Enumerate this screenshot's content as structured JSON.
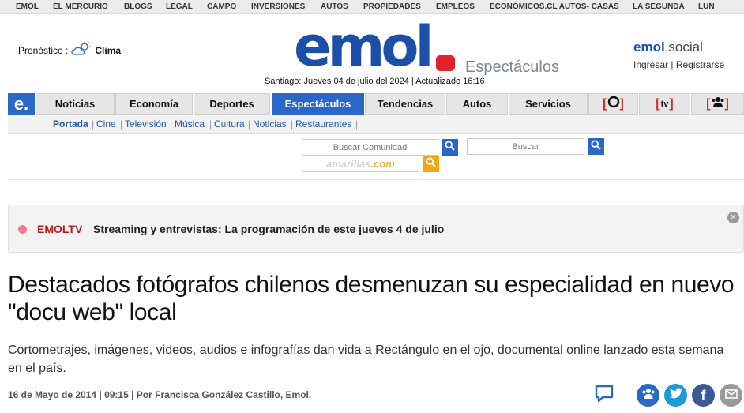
{
  "topbar": {
    "links": [
      "EMOL",
      "EL MERCURIO",
      "BLOGS",
      "LEGAL",
      "CAMPO",
      "INVERSIONES",
      "AUTOS",
      "PROPIEDADES",
      "EMPLEOS",
      "ECONÓMICOS.CL AUTOS- CASAS",
      "LA SEGUNDA",
      "LUN"
    ]
  },
  "header": {
    "forecast_label": "Pronóstico :",
    "forecast_link": "Clima",
    "logo": "emol",
    "section": "Espectáculos",
    "date_line": "Santiago: Jueves 04 de julio del 2024 | Actualizado 16:16",
    "social": {
      "logo_main": "emol",
      "logo_dot": ".",
      "logo_suffix": "social",
      "login": "Ingresar",
      "separator": "|",
      "register": "Registrarse"
    }
  },
  "nav": {
    "logo": "e.",
    "tabs": [
      "Noticias",
      "Economía",
      "Deportes",
      "Espectáculos",
      "Tendencias",
      "Autos",
      "Servicios"
    ],
    "active_tab": "Espectáculos",
    "icon_tabs": [
      "radio-icon",
      "tv-icon",
      "community-icon"
    ],
    "tv_icon_text": "tv"
  },
  "subnav": {
    "items": [
      "Portada",
      "Cine",
      "Televisión",
      "Música",
      "Cultura",
      "Noticias",
      "Restaurantes"
    ],
    "separator": "|"
  },
  "search": {
    "community_placeholder": "Buscar Comunidad",
    "site_placeholder": "Buscar",
    "amarillas_brand": "amarillas",
    "amarillas_suffix": ".com"
  },
  "alert": {
    "tag": "EMOLTV",
    "text": "Streaming y entrevistas: La programación de este jueves 4 de julio"
  },
  "article": {
    "headline": "Destacados fotógrafos chilenos desmenuzan su especialidad en nuevo \"docu web\" local",
    "summary": "Cortometrajes, imágenes, videos, audios e infografías dan vida a Rectángulo en el ojo, documental online lanzado esta semana en el país.",
    "byline": "16 de Mayo de 2014 | 09:15 | Por Francisca González Castillo, Emol."
  },
  "colors": {
    "brand_blue": "#1b4fa8",
    "nav_blue": "#2b67c6",
    "brand_red": "#e2212c",
    "twitter": "#1d9bd8",
    "facebook": "#3b5998",
    "mail": "#9a9a9a"
  }
}
